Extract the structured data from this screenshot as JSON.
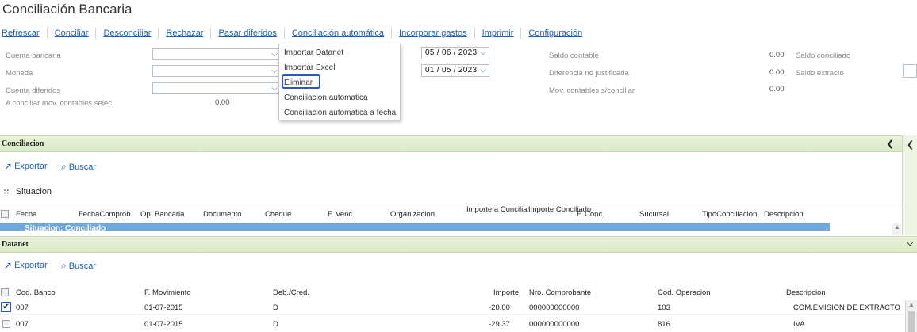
{
  "page": {
    "title": "Conciliación Bancaria"
  },
  "toolbar": [
    "Refrescar",
    "Conciliar",
    "Desconciliar",
    "Rechazar",
    "Pasar diferidos",
    "Conciliación automática",
    "Incorporar gastos",
    "Imprimir",
    "Configuración"
  ],
  "form": {
    "cuenta_bancaria": "Cuenta bancaria",
    "moneda": "Moneda",
    "cuenta_diferidos": "Cuenta diferidos",
    "a_conciliar": "A conciliar mov. contables selec.",
    "a_conciliar_value": "0.00",
    "date1": "05 / 06 /  2023",
    "date2": "01 / 05 /  2023",
    "saldo_contable": "Saldo contable",
    "saldo_contable_value": "0.00",
    "saldo_conciliado": "Saldo conciliado",
    "diferencia": "Diferencia no justificada",
    "diferencia_value": "0.00",
    "saldo_extracto": "Saldo extracto",
    "mov_contables": "Mov. contables s/conciliar",
    "mov_contables_value": "0.00"
  },
  "menu": {
    "items": [
      "Importar Datanet",
      "Importar Excel",
      "Eliminar",
      "Conciliacion automatica",
      "Conciliacion automatica a fecha"
    ]
  },
  "conciliacion": {
    "header": "Conciliacion",
    "exportar": "Exportar",
    "buscar": "Buscar",
    "group_label": "Situacion",
    "columns": [
      "Fecha",
      "FechaComproba",
      "Op. Bancaria",
      "Documento",
      "Cheque",
      "F. Venc.",
      "Organizacion",
      "Importe a Conciliar",
      "Importe Conciliado",
      "F. Conc.",
      "Sucursal",
      "TipoConciliacion",
      "Descripcion"
    ],
    "group_row": "Situacion: Conciliado"
  },
  "datanet": {
    "header": "Datanet",
    "exportar": "Exportar",
    "buscar": "Buscar",
    "columns": [
      "Cod. Banco",
      "F. Movimiento",
      "Deb./Cred.",
      "Importe",
      "Nro. Comprobante",
      "Cod. Operacion",
      "Descripcion"
    ],
    "rows": [
      {
        "banco": "007",
        "fecha": "01-07-2015",
        "debcred": "D",
        "importe": "-20.00",
        "comprobante": "000000000000",
        "operacion": "103",
        "descripcion": "COM.EMISION DE EXTRACTO Q"
      },
      {
        "banco": "007",
        "fecha": "01-07-2015",
        "debcred": "D",
        "importe": "-29.37",
        "comprobante": "000000000000",
        "operacion": "816",
        "descripcion": "IVA"
      }
    ]
  },
  "colors": {
    "link": "#1f5fb0",
    "section": "#d9eac4",
    "selection": "#6fa8dc",
    "highlight": "#2a57c4"
  }
}
